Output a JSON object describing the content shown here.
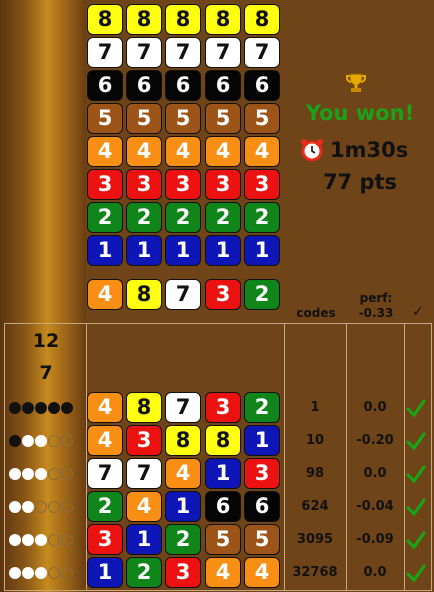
{
  "palette": {
    "1": "#0e16b8",
    "2": "#10861a",
    "3": "#ec1212",
    "4": "#f98e14",
    "5": "#9c5418",
    "6": "#050505",
    "7": "#ffffff",
    "8": "#ffff10"
  },
  "color_grid": [
    [
      "8",
      "8",
      "8",
      "8",
      "8"
    ],
    [
      "7",
      "7",
      "7",
      "7",
      "7"
    ],
    [
      "6",
      "6",
      "6",
      "6",
      "6"
    ],
    [
      "5",
      "5",
      "5",
      "5",
      "5"
    ],
    [
      "4",
      "4",
      "4",
      "4",
      "4"
    ],
    [
      "3",
      "3",
      "3",
      "3",
      "3"
    ],
    [
      "2",
      "2",
      "2",
      "2",
      "2"
    ],
    [
      "1",
      "1",
      "1",
      "1",
      "1"
    ]
  ],
  "secret_code": [
    "4",
    "8",
    "7",
    "3",
    "2"
  ],
  "status": {
    "trophy_icon": "trophy-icon",
    "message": "You won!",
    "alarm_icon": "alarm-clock-icon",
    "time": "1m30s",
    "points": "77 pts"
  },
  "table": {
    "col_codes": "codes",
    "col_perf_label": "perf:",
    "col_perf_value": "-0.33",
    "col_check": "✓",
    "counter_top": "12",
    "counter_bottom": "7"
  },
  "guesses": [
    {
      "pegs": [
        "4",
        "8",
        "7",
        "3",
        "2"
      ],
      "feedback": [
        "b",
        "b",
        "b",
        "b",
        "b"
      ],
      "codes": "1",
      "perf": "0.0"
    },
    {
      "pegs": [
        "4",
        "3",
        "8",
        "8",
        "1"
      ],
      "feedback": [
        "b",
        "w",
        "w",
        "e",
        "e"
      ],
      "codes": "10",
      "perf": "-0.20"
    },
    {
      "pegs": [
        "7",
        "7",
        "4",
        "1",
        "3"
      ],
      "feedback": [
        "w",
        "w",
        "w",
        "e",
        "e"
      ],
      "codes": "98",
      "perf": "0.0"
    },
    {
      "pegs": [
        "2",
        "4",
        "1",
        "6",
        "6"
      ],
      "feedback": [
        "w",
        "w",
        "e",
        "e",
        "e"
      ],
      "codes": "624",
      "perf": "-0.04"
    },
    {
      "pegs": [
        "3",
        "1",
        "2",
        "5",
        "5"
      ],
      "feedback": [
        "w",
        "w",
        "w",
        "e",
        "e"
      ],
      "codes": "3095",
      "perf": "-0.09"
    },
    {
      "pegs": [
        "1",
        "2",
        "3",
        "4",
        "4"
      ],
      "feedback": [
        "w",
        "w",
        "w",
        "e",
        "e"
      ],
      "codes": "32768",
      "perf": "0.0"
    }
  ]
}
